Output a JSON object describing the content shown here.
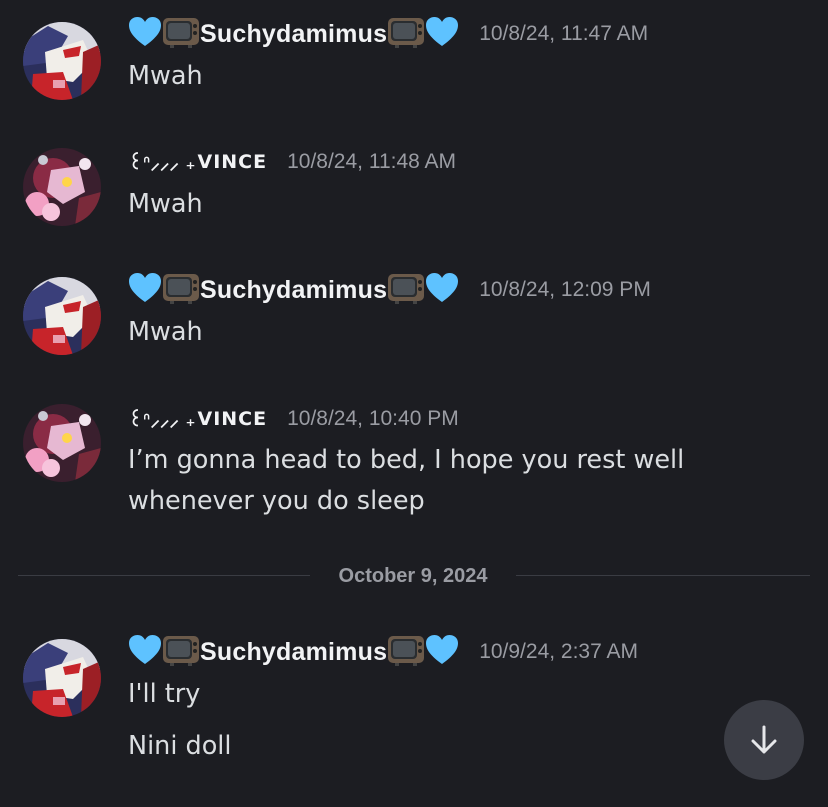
{
  "messages": [
    {
      "author": "Suchydamimus",
      "author_style": "heart-tv",
      "timestamp": "10/8/24, 11:47 AM",
      "lines": [
        "Mwah"
      ],
      "avatar": "suchy-avatar"
    },
    {
      "author": "VINCE",
      "author_prefix": "꒰ᐢ⸝⸝⸝ ₊",
      "author_style": "vince",
      "timestamp": "10/8/24, 11:48 AM",
      "lines": [
        "Mwah"
      ],
      "avatar": "vince-avatar"
    },
    {
      "author": "Suchydamimus",
      "author_style": "heart-tv",
      "timestamp": "10/8/24, 12:09 PM",
      "lines": [
        "Mwah"
      ],
      "avatar": "suchy-avatar"
    },
    {
      "author": "VINCE",
      "author_prefix": "꒰ᐢ⸝⸝⸝ ₊",
      "author_style": "vince",
      "timestamp": "10/8/24, 10:40 PM",
      "lines": [
        "I’m gonna head to bed, I hope you rest well",
        "whenever you do sleep"
      ],
      "avatar": "vince-avatar"
    },
    {
      "author": "Suchydamimus",
      "author_style": "heart-tv",
      "timestamp": "10/9/24, 2:37 AM",
      "lines": [
        "I'll try",
        "Nini doll"
      ],
      "avatar": "suchy-avatar"
    }
  ],
  "date_divider": {
    "label": "October 9, 2024"
  },
  "scroll_button": {
    "icon": "arrow-down-icon"
  },
  "colors": {
    "background": "#1c1d22",
    "username": "#f2f3f5",
    "timestamp": "#9a9ca3",
    "text": "#dbdee1",
    "heart": "#5ec2ff",
    "button": "#3b3d45"
  }
}
